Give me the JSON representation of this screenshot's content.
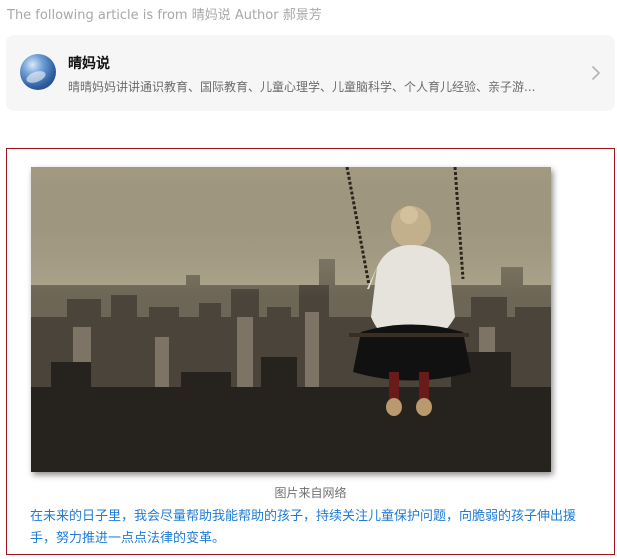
{
  "source_line": "The following article is from 晴妈说 Author 郝景芳",
  "profile": {
    "name": "晴妈说",
    "description": "晴晴妈妈讲讲通识教育、国际教育、儿童心理学、儿童脑科学、个人育儿经验、亲子游..."
  },
  "icons": {
    "avatar": "globe-avatar-icon",
    "chevron": "chevron-right-icon"
  },
  "article": {
    "image_alt": "girl-on-swing-over-city",
    "caption": "图片来自网络",
    "body": "在未来的日子里，我会尽量帮助我能帮助的孩子，持续关注儿童保护问题，向脆弱的孩子伸出援手，努力推进一点点法律的变革。"
  },
  "colors": {
    "frame_border": "#a3131e",
    "body_text": "#1f7bd6"
  }
}
